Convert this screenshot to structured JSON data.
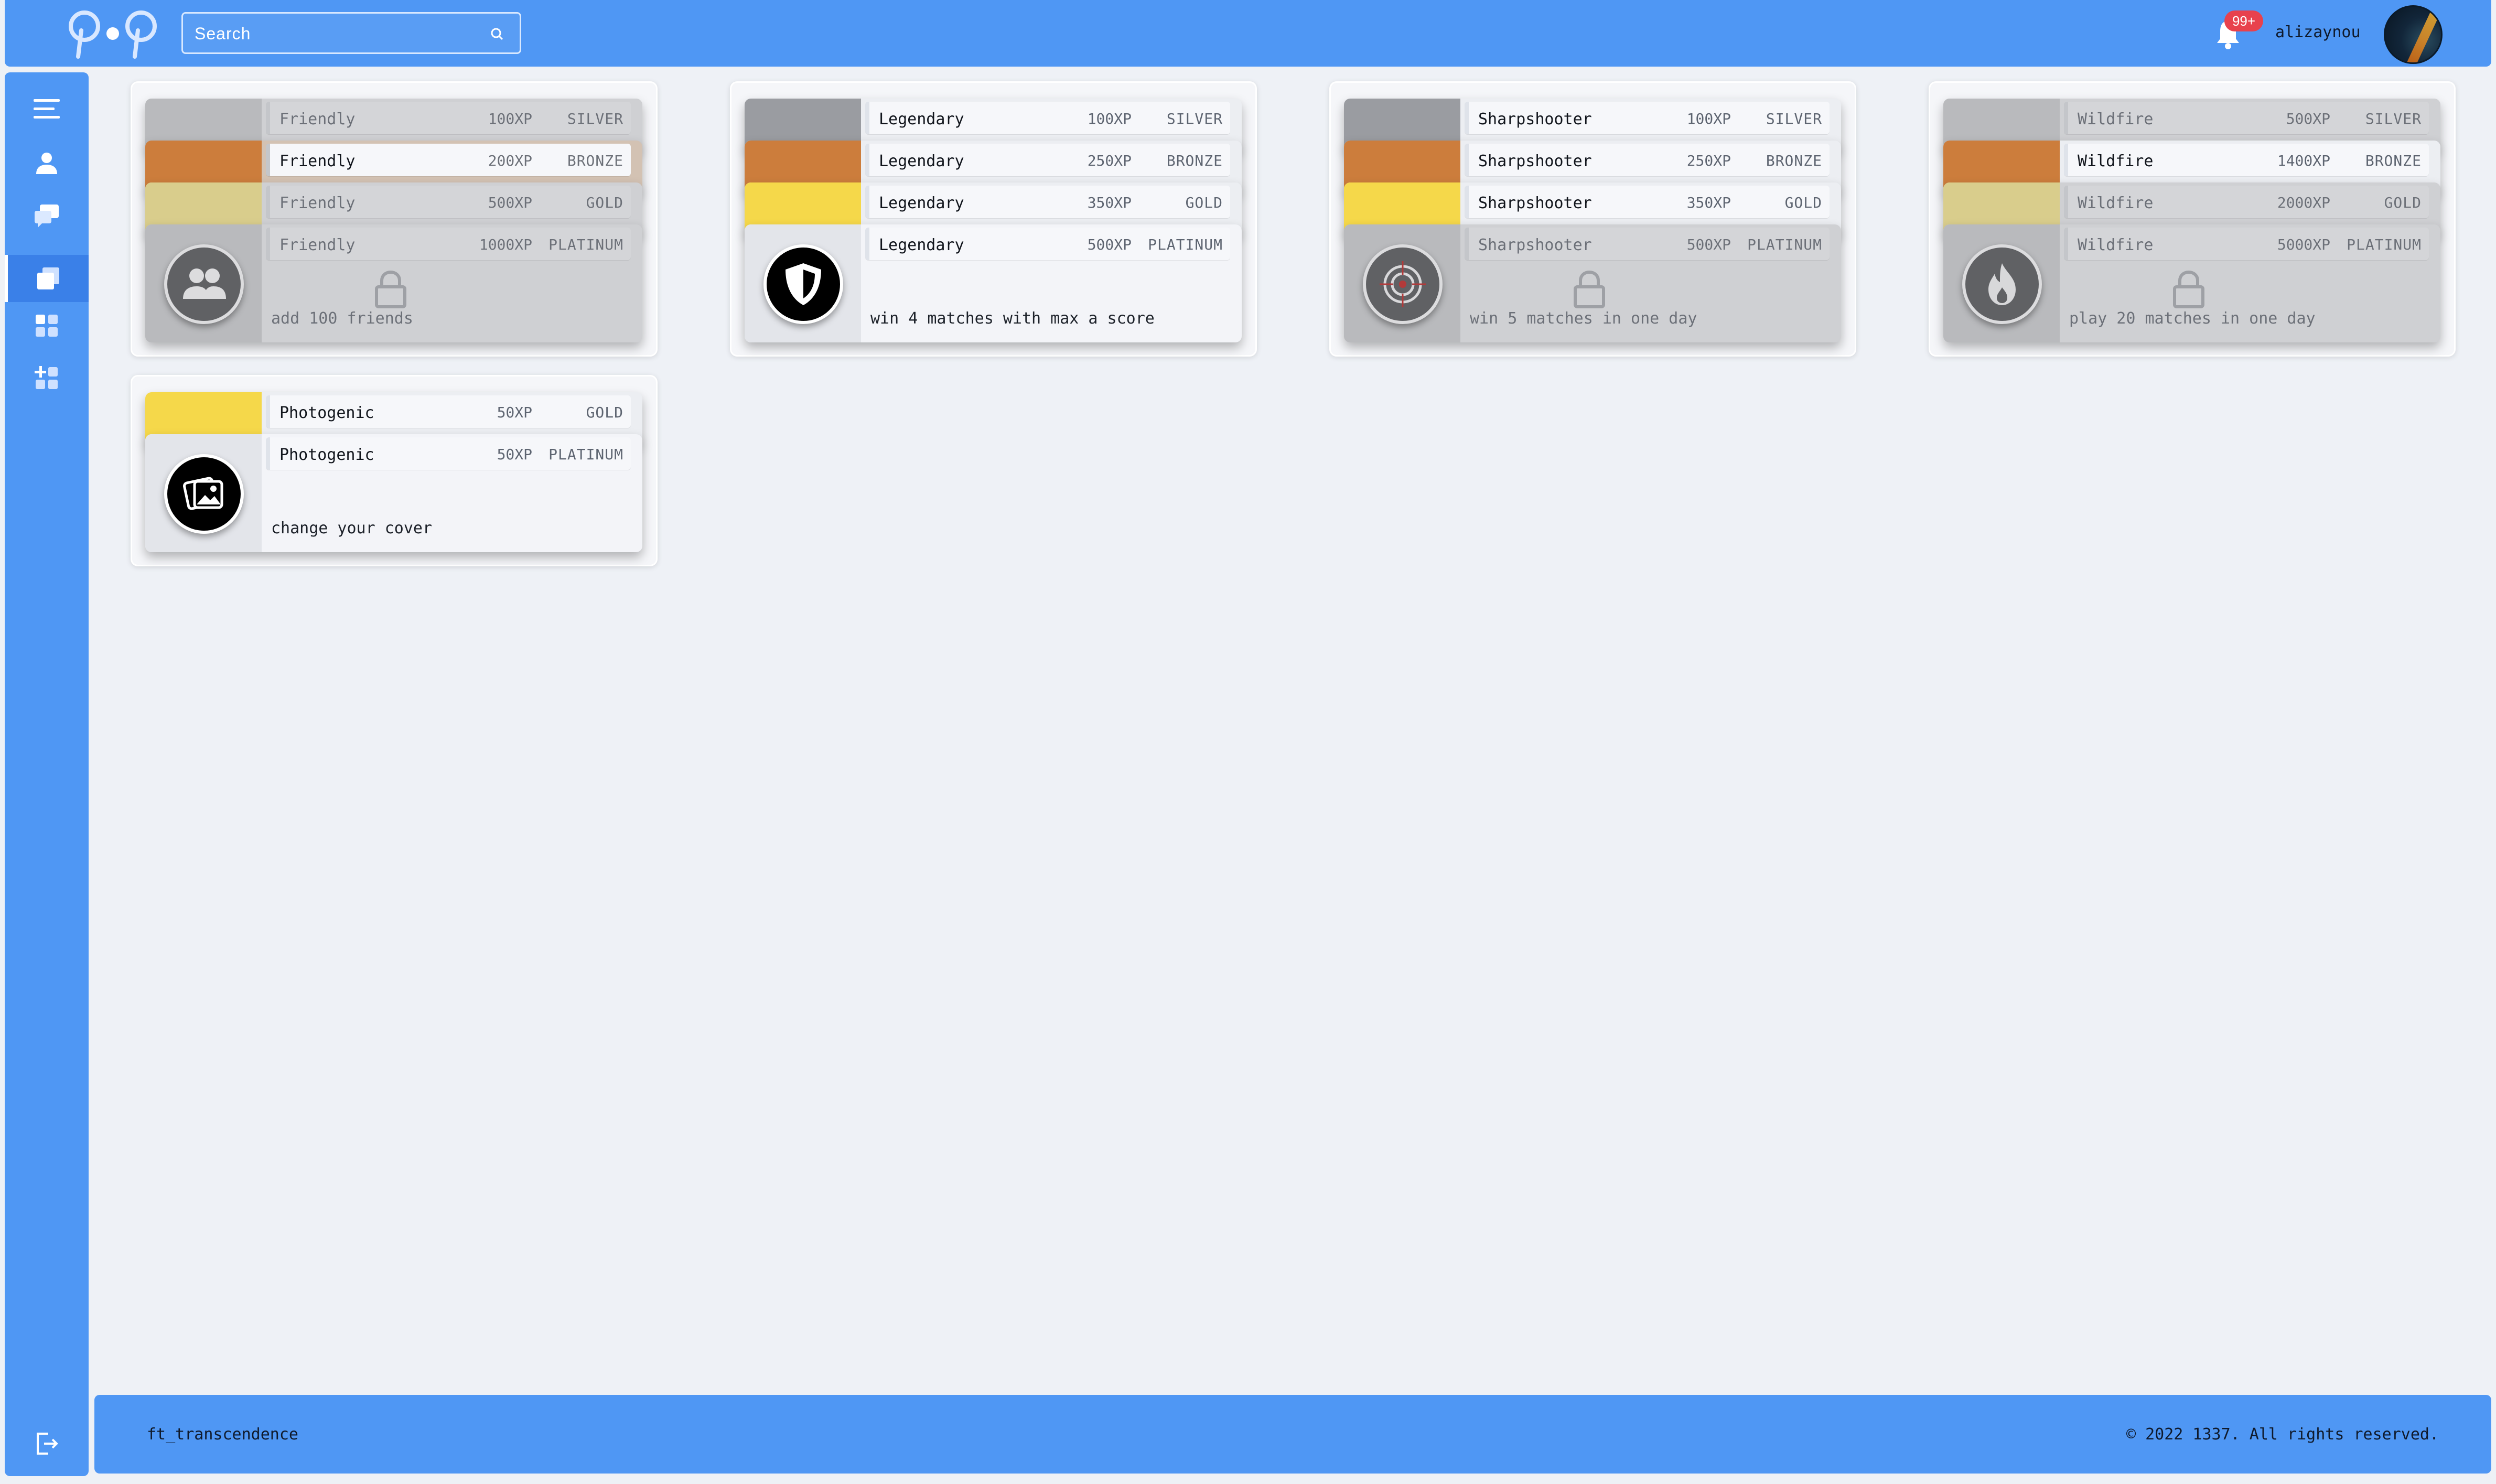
{
  "header": {
    "search_placeholder": "Search",
    "notifications_badge": "99+",
    "username": "alizaynou"
  },
  "sidebar": {
    "items": [
      {
        "name": "menu-icon"
      },
      {
        "name": "profile-icon"
      },
      {
        "name": "chat-icon"
      },
      {
        "name": "achievements-icon",
        "active": true
      },
      {
        "name": "dashboard-icon"
      },
      {
        "name": "add-widget-icon"
      },
      {
        "name": "logout-icon"
      }
    ]
  },
  "achievements": {
    "friendly": {
      "silver": {
        "name": "Friendly",
        "xp": "100XP",
        "tier": "SILVER"
      },
      "bronze": {
        "name": "Friendly",
        "xp": "200XP",
        "tier": "BRONZE"
      },
      "gold": {
        "name": "Friendly",
        "xp": "500XP",
        "tier": "GOLD"
      },
      "platinum": {
        "name": "Friendly",
        "xp": "1000XP",
        "tier": "PLATINUM"
      },
      "desc": "add 100 friends",
      "icon": "friends-icon",
      "locked": true
    },
    "legendary": {
      "silver": {
        "name": "Legendary",
        "xp": "100XP",
        "tier": "SILVER"
      },
      "bronze": {
        "name": "Legendary",
        "xp": "250XP",
        "tier": "BRONZE"
      },
      "gold": {
        "name": "Legendary",
        "xp": "350XP",
        "tier": "GOLD"
      },
      "platinum": {
        "name": "Legendary",
        "xp": "500XP",
        "tier": "PLATINUM"
      },
      "desc": "win 4 matches with max a score",
      "icon": "shield-icon",
      "locked": false
    },
    "sharpshooter": {
      "silver": {
        "name": "Sharpshooter",
        "xp": "100XP",
        "tier": "SILVER"
      },
      "bronze": {
        "name": "Sharpshooter",
        "xp": "250XP",
        "tier": "BRONZE"
      },
      "gold": {
        "name": "Sharpshooter",
        "xp": "350XP",
        "tier": "GOLD"
      },
      "platinum": {
        "name": "Sharpshooter",
        "xp": "500XP",
        "tier": "PLATINUM"
      },
      "desc": "win 5 matches in one day",
      "icon": "target-icon",
      "locked": true
    },
    "wildfire": {
      "silver": {
        "name": "Wildfire",
        "xp": "500XP",
        "tier": "SILVER"
      },
      "bronze": {
        "name": "Wildfire",
        "xp": "1400XP",
        "tier": "BRONZE"
      },
      "gold": {
        "name": "Wildfire",
        "xp": "2000XP",
        "tier": "GOLD"
      },
      "platinum": {
        "name": "Wildfire",
        "xp": "5000XP",
        "tier": "PLATINUM"
      },
      "desc": "play 20 matches in one day",
      "icon": "flame-icon",
      "locked": true
    },
    "photogenic": {
      "gold": {
        "name": "Photogenic",
        "xp": "50XP",
        "tier": "GOLD"
      },
      "platinum": {
        "name": "Photogenic",
        "xp": "50XP",
        "tier": "PLATINUM"
      },
      "desc": "change your cover",
      "icon": "images-icon",
      "locked": false
    }
  },
  "colors": {
    "accent": "#4f97f4",
    "silver": "#9a9ca1",
    "bronze": "#cc7d3c",
    "gold": "#f5d84a"
  },
  "footer": {
    "left": "ft_transcendence",
    "right": "© 2022 1337. All rights reserved."
  }
}
